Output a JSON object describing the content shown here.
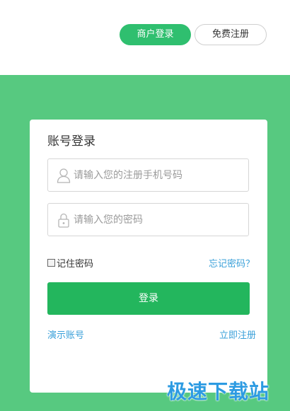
{
  "header": {
    "merchant_login_label": "商户登录",
    "free_register_label": "免费注册"
  },
  "login_card": {
    "title": "账号登录",
    "username_placeholder": "请输入您的注册手机号码",
    "password_placeholder": "请输入您的密码",
    "remember_label": "记住密码",
    "forgot_label": "忘记密码？",
    "login_button_label": "登录",
    "demo_account_label": "演示账号",
    "register_now_label": "立即注册"
  },
  "icons": {
    "username_icon": "user-icon",
    "password_icon": "lock-icon"
  },
  "colors": {
    "brand_green": "#57c980",
    "button_green": "#23b65d",
    "link_blue": "#3aa0d9"
  },
  "watermark": "极速下载站"
}
